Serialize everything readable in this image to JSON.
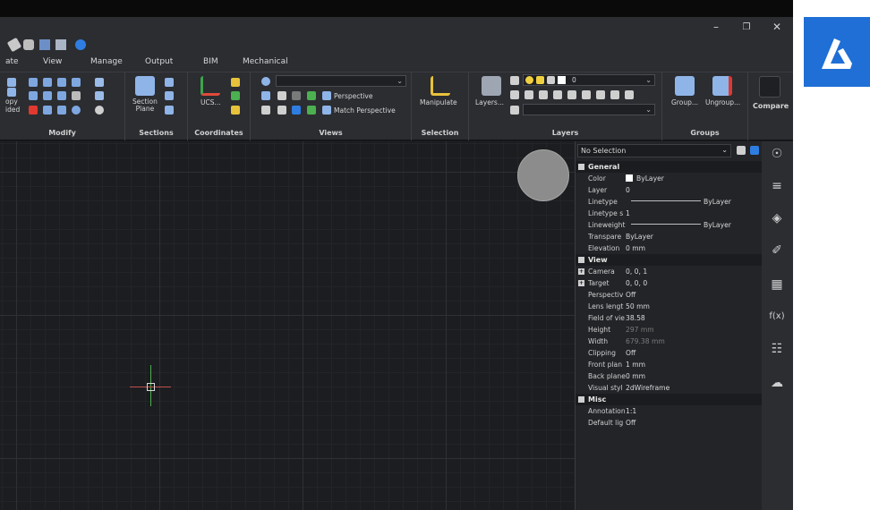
{
  "window": {
    "minimize_glyph": "–",
    "restore_glyph": "❐",
    "close_glyph": "✕"
  },
  "tabs": [
    "ate",
    "View",
    "Manage",
    "Output",
    "BIM",
    "Mechanical"
  ],
  "ribbon": {
    "modify": {
      "label": "Modify",
      "left_labels": [
        "ору",
        "ided"
      ]
    },
    "sections": {
      "label": "Sections",
      "section_plane": "Section\nPlane"
    },
    "coordinates": {
      "label": "Coordinates",
      "ucs": "UCS..."
    },
    "views": {
      "label": "Views",
      "perspective": "Perspective",
      "match_perspective": "Match Perspective"
    },
    "selection": {
      "label": "Selection",
      "manipulate": "Manipulate"
    },
    "layers": {
      "label": "Layers",
      "layers_button": "Layers...",
      "current_layer": "0"
    },
    "groups": {
      "label": "Groups",
      "group": "Group...",
      "ungroup": "Ungroup..."
    },
    "compare": {
      "label": "Compare"
    }
  },
  "properties": {
    "selection": "No Selection",
    "sections": [
      {
        "title": "General",
        "rows": [
          {
            "key": "Color",
            "value": "ByLayer",
            "swatch": "#ffffff"
          },
          {
            "key": "Layer",
            "value": "0"
          },
          {
            "key": "Linetype",
            "value": "ByLayer",
            "line": true
          },
          {
            "key": "Linetype s",
            "value": "1"
          },
          {
            "key": "Lineweight",
            "value": "ByLayer",
            "line": true
          },
          {
            "key": "Transpare",
            "value": "ByLayer"
          },
          {
            "key": "Elevation",
            "value": "0 mm"
          }
        ]
      },
      {
        "title": "View",
        "rows": [
          {
            "key": "Camera",
            "value": "0, 0, 1",
            "expandable": true
          },
          {
            "key": "Target",
            "value": "0, 0, 0",
            "expandable": true
          },
          {
            "key": "Perspectiv",
            "value": "Off"
          },
          {
            "key": "Lens lengt",
            "value": "50 mm"
          },
          {
            "key": "Field of vie",
            "value": "38.58"
          },
          {
            "key": "Height",
            "value": "297 mm",
            "dim": true
          },
          {
            "key": "Width",
            "value": "679.38 mm",
            "dim": true
          },
          {
            "key": "Clipping",
            "value": "Off"
          },
          {
            "key": "Front plan",
            "value": "1 mm"
          },
          {
            "key": "Back plane",
            "value": "0 mm"
          },
          {
            "key": "Visual styl",
            "value": "2dWireframe"
          }
        ]
      },
      {
        "title": "Misc",
        "rows": [
          {
            "key": "Annotation",
            "value": "1:1"
          },
          {
            "key": "Default lig",
            "value": "Off"
          }
        ]
      }
    ]
  },
  "rightbar_icons": [
    "lightbulb-icon",
    "sliders-icon",
    "layers-stack-icon",
    "paperclip-icon",
    "hatch-grid-icon",
    "function-icon",
    "tree-structure-icon",
    "cloud-upload-icon"
  ],
  "rightbar_glyphs": [
    "☉",
    "≡",
    "◈",
    "✐",
    "▦",
    "f(x)",
    "☷",
    "☁"
  ],
  "colors": {
    "brand": "#1f6fd6",
    "canvas": "#1c1d20",
    "ribbon": "#2b2d31",
    "crosshair_x": "#c0504d",
    "crosshair_y": "#4caf50"
  }
}
